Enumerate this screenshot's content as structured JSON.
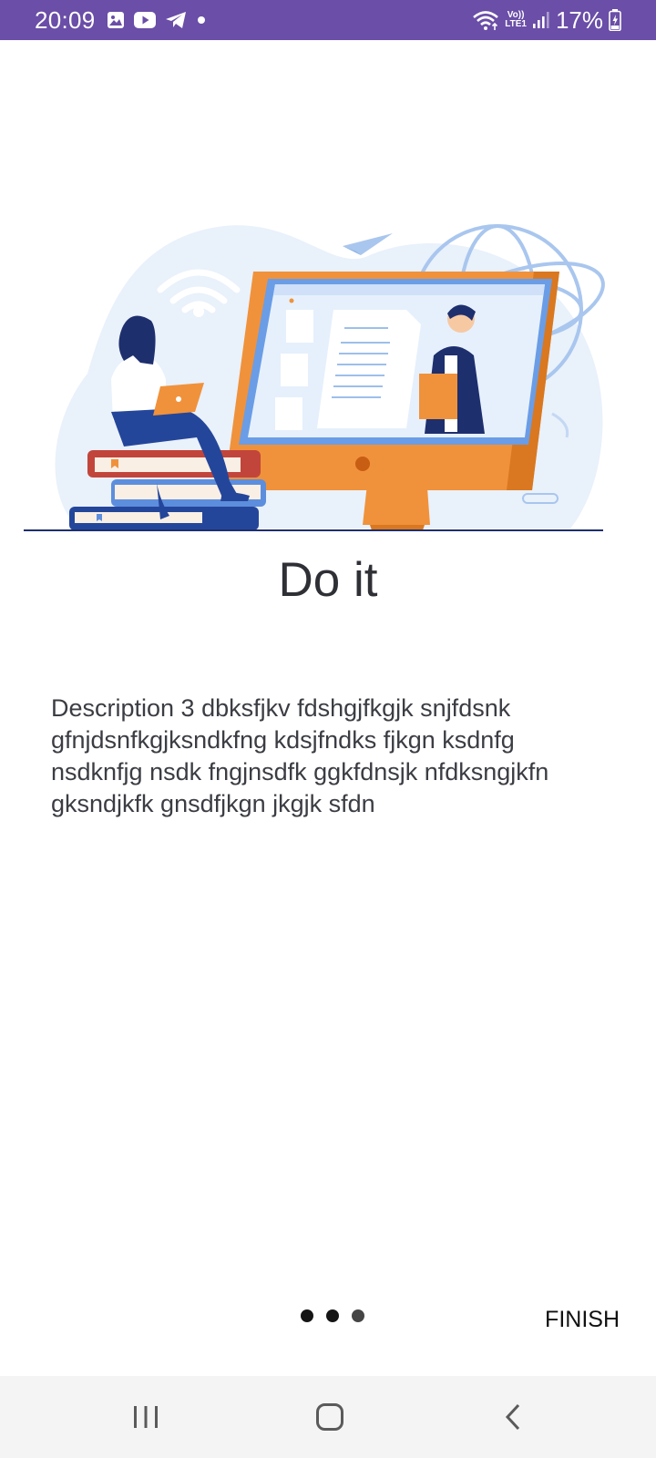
{
  "status_bar": {
    "time": "20:09",
    "left_icons": [
      "gallery-icon",
      "youtube-icon",
      "telegram-icon",
      "notification-dot-icon"
    ],
    "right_icons": [
      "wifi-icon",
      "volte-icon",
      "signal-icon"
    ],
    "network_label_top": "Vo))",
    "network_label_bottom": "LTE1",
    "battery_percent": "17%",
    "background_color": "#6a4ea7"
  },
  "onboarding": {
    "illustration": "online-learning-illustration",
    "title": "Do it",
    "description": "Description 3 dbksfjkv fdshgjfkgjk snjfdsnk gfnjdsnfkgjksndkfng kdsjfndks fjkgn ksdnfg nsdknfjg nsdk fngjnsdfk ggkfdnsjk nfdksngjkfn gksndjkfk gnsdfjkgn jkgjk sfdn",
    "page_indicator": {
      "count": 3,
      "current": 3
    },
    "finish_label": "FINISH"
  },
  "nav_bar": {
    "buttons": [
      "recents-icon",
      "home-icon",
      "back-icon"
    ]
  }
}
